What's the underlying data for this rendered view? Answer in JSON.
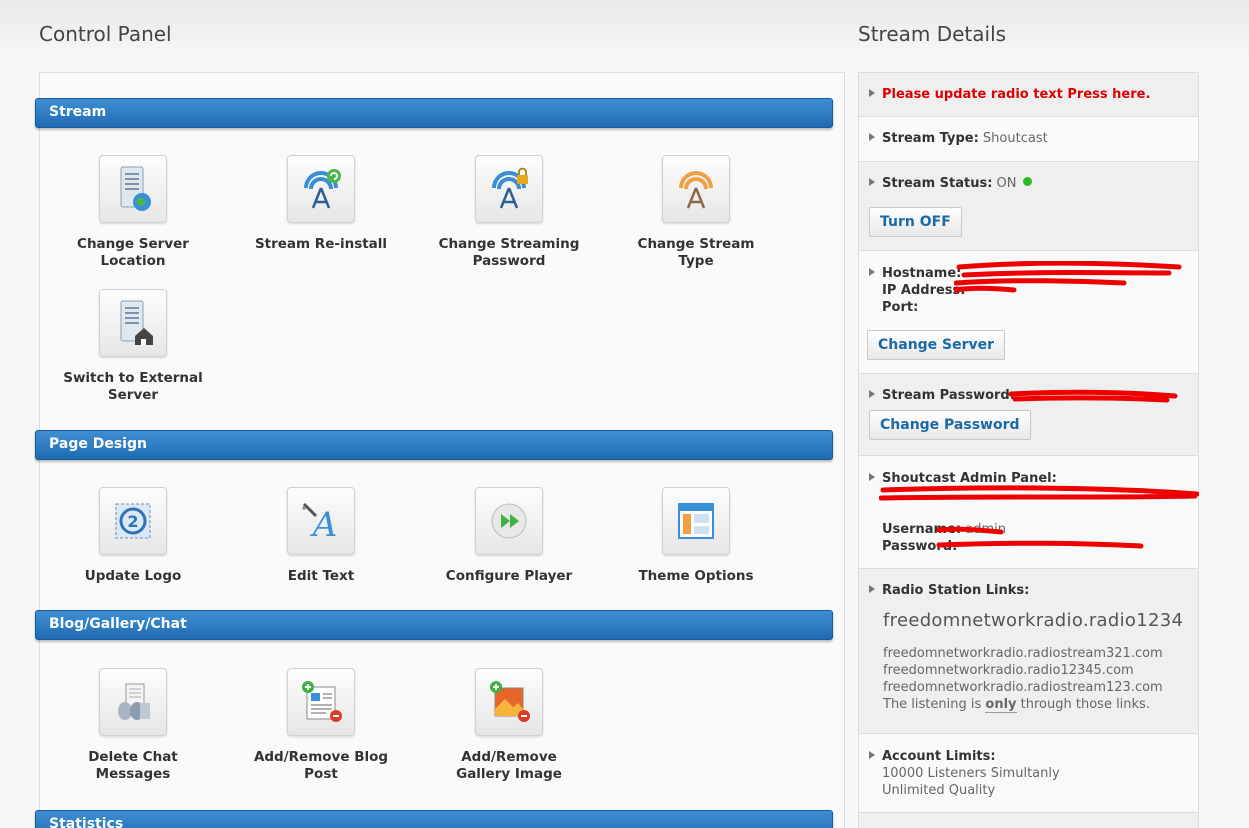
{
  "control_panel": {
    "title": "Control Panel",
    "sections": [
      {
        "name": "Stream"
      },
      {
        "name": "Page Design"
      },
      {
        "name": "Blog/Gallery/Chat"
      },
      {
        "name": "Statistics"
      }
    ],
    "stream_tiles": [
      {
        "label": "Change Server Location",
        "icon": "server-globe-icon"
      },
      {
        "label": "Stream Re-install",
        "icon": "antenna-refresh-icon"
      },
      {
        "label": "Change Streaming Password",
        "icon": "antenna-lock-icon"
      },
      {
        "label": "Change Stream Type",
        "icon": "antenna-orange-icon"
      },
      {
        "label": "Switch to External Server",
        "icon": "server-home-icon"
      }
    ],
    "design_tiles": [
      {
        "label": "Update Logo",
        "icon": "logo-icon"
      },
      {
        "label": "Edit Text",
        "icon": "edit-text-icon"
      },
      {
        "label": "Configure Player",
        "icon": "play-icon"
      },
      {
        "label": "Theme Options",
        "icon": "layout-icon"
      }
    ],
    "blog_tiles": [
      {
        "label": "Delete Chat Messages",
        "icon": "chat-delete-icon"
      },
      {
        "label": "Add/Remove Blog Post",
        "icon": "blog-post-icon"
      },
      {
        "label": "Add/Remove Gallery Image",
        "icon": "gallery-image-icon"
      }
    ]
  },
  "stream_details": {
    "title": "Stream Details",
    "update_notice": "Please update radio text Press here.",
    "stream_type_label": "Stream Type:",
    "stream_type_value": "Shoutcast",
    "stream_status_label": "Stream Status:",
    "stream_status_value": "ON",
    "status_color": "#28b928",
    "turn_off_button": "Turn OFF",
    "hostname_label": "Hostname:",
    "ip_label": "IP Address:",
    "port_label": "Port:",
    "change_server_button": "Change Server",
    "stream_password_label": "Stream Password:",
    "change_password_button": "Change Password",
    "admin_panel_label": "Shoutcast Admin Panel:",
    "username_label": "Username:",
    "username_value": "admin",
    "password_label": "Password:",
    "radio_links_label": "Radio Station Links:",
    "primary_link": "freedomnetworkradio.radio1234",
    "links": [
      "freedomnetworkradio.radiostream321.com",
      "freedomnetworkradio.radio12345.com",
      "freedomnetworkradio.radiostream123.com"
    ],
    "listening_note_pre": "The listening is ",
    "listening_note_bold": "only",
    "listening_note_post": " through those links.",
    "account_limits_label": "Account Limits:",
    "limit_listeners": "10000 Listeners Simultanly",
    "limit_quality": "Unlimited Quality"
  },
  "colors": {
    "section_bar": "#2a7cc5",
    "alert_red": "#dd0000",
    "button_text": "#1b6aa8"
  }
}
